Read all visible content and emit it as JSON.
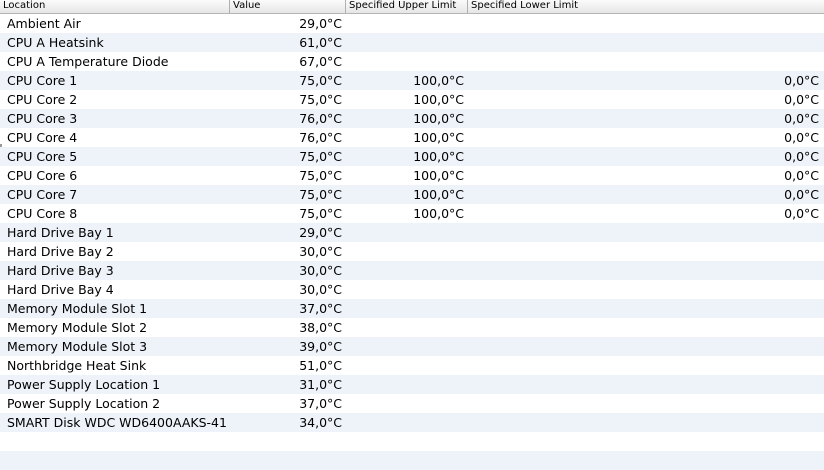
{
  "columns": {
    "location": "Location",
    "value": "Value",
    "upper": "Specified Upper Limit",
    "lower": "Specified Lower Limit"
  },
  "rows": [
    {
      "location": "Ambient Air",
      "value": "29,0°C",
      "upper": "",
      "lower": ""
    },
    {
      "location": "CPU A Heatsink",
      "value": "61,0°C",
      "upper": "",
      "lower": ""
    },
    {
      "location": "CPU A Temperature Diode",
      "value": "67,0°C",
      "upper": "",
      "lower": ""
    },
    {
      "location": "CPU Core 1",
      "value": "75,0°C",
      "upper": "100,0°C",
      "lower": "0,0°C"
    },
    {
      "location": "CPU Core 2",
      "value": "75,0°C",
      "upper": "100,0°C",
      "lower": "0,0°C"
    },
    {
      "location": "CPU Core 3",
      "value": "76,0°C",
      "upper": "100,0°C",
      "lower": "0,0°C"
    },
    {
      "location": "CPU Core 4",
      "value": "76,0°C",
      "upper": "100,0°C",
      "lower": "0,0°C"
    },
    {
      "location": "CPU Core 5",
      "value": "75,0°C",
      "upper": "100,0°C",
      "lower": "0,0°C"
    },
    {
      "location": "CPU Core 6",
      "value": "75,0°C",
      "upper": "100,0°C",
      "lower": "0,0°C"
    },
    {
      "location": "CPU Core 7",
      "value": "75,0°C",
      "upper": "100,0°C",
      "lower": "0,0°C"
    },
    {
      "location": "CPU Core 8",
      "value": "75,0°C",
      "upper": "100,0°C",
      "lower": "0,0°C"
    },
    {
      "location": "Hard Drive Bay 1",
      "value": "29,0°C",
      "upper": "",
      "lower": ""
    },
    {
      "location": "Hard Drive Bay 2",
      "value": "30,0°C",
      "upper": "",
      "lower": ""
    },
    {
      "location": "Hard Drive Bay 3",
      "value": "30,0°C",
      "upper": "",
      "lower": ""
    },
    {
      "location": "Hard Drive Bay 4",
      "value": "30,0°C",
      "upper": "",
      "lower": ""
    },
    {
      "location": "Memory Module Slot 1",
      "value": "37,0°C",
      "upper": "",
      "lower": ""
    },
    {
      "location": "Memory Module Slot 2",
      "value": "38,0°C",
      "upper": "",
      "lower": ""
    },
    {
      "location": "Memory Module Slot 3",
      "value": "39,0°C",
      "upper": "",
      "lower": ""
    },
    {
      "location": "Northbridge Heat Sink",
      "value": "51,0°C",
      "upper": "",
      "lower": ""
    },
    {
      "location": "Power Supply Location 1",
      "value": "31,0°C",
      "upper": "",
      "lower": ""
    },
    {
      "location": "Power Supply Location 2",
      "value": "37,0°C",
      "upper": "",
      "lower": ""
    },
    {
      "location": "SMART Disk WDC WD6400AAKS-41",
      "value": "34,0°C",
      "upper": "",
      "lower": ""
    },
    {
      "location": "",
      "value": "",
      "upper": "",
      "lower": ""
    },
    {
      "location": "",
      "value": "",
      "upper": "",
      "lower": ""
    }
  ]
}
